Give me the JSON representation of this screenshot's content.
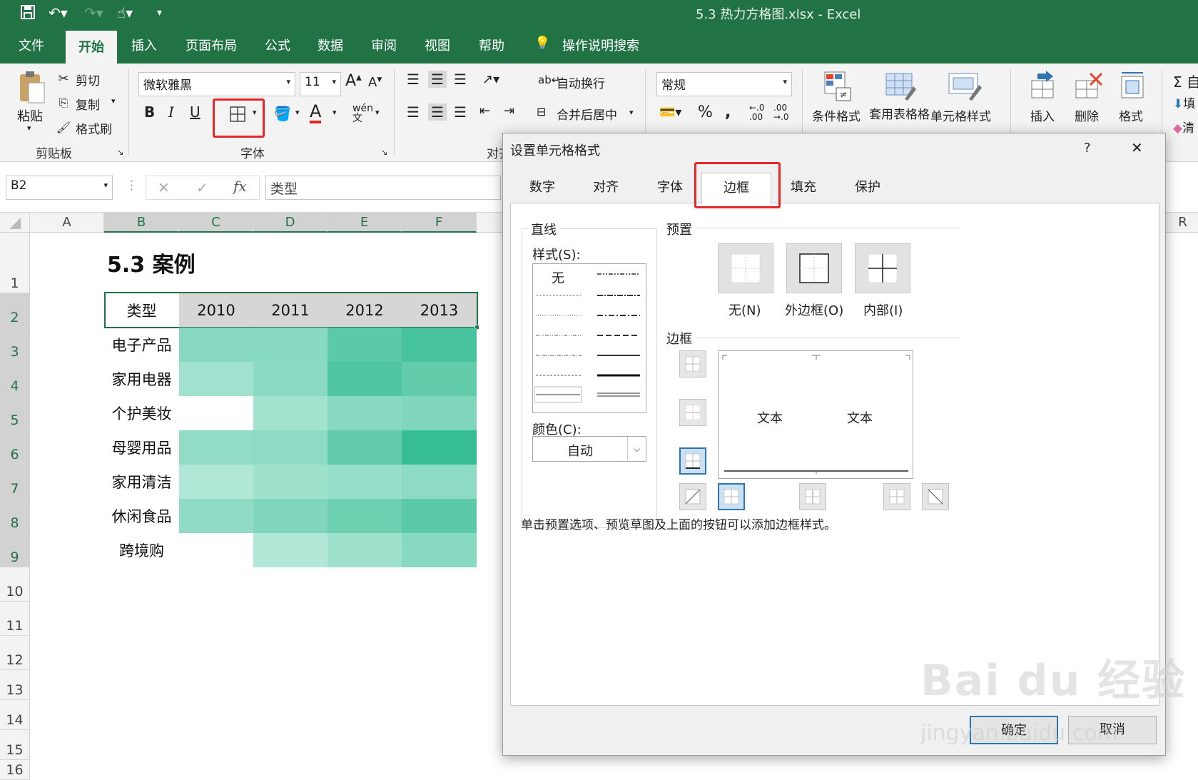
{
  "window": {
    "title": "5.3 热力方格图.xlsx  -  Excel"
  },
  "menu_tabs": [
    "文件",
    "开始",
    "插入",
    "页面布局",
    "公式",
    "数据",
    "审阅",
    "视图",
    "帮助"
  ],
  "tell_me": "操作说明搜索",
  "ribbon": {
    "clipboard": {
      "paste": "粘贴",
      "cut": "剪切",
      "copy": "复制",
      "format_painter": "格式刷",
      "label": "剪贴板"
    },
    "font": {
      "name": "微软雅黑",
      "size": "11",
      "bold": "B",
      "italic": "I",
      "underline": "U",
      "label": "字体"
    },
    "alignment": {
      "wrap": "自动换行",
      "merge": "合并后居中",
      "label": "对齐"
    },
    "number": {
      "format": "常规"
    },
    "styles": {
      "conditional": "条件格式",
      "table_format": "套用表格格式",
      "cell_styles": "单元格样式"
    },
    "cells": {
      "insert": "插入",
      "delete": "删除",
      "format": "格式"
    },
    "editing": {
      "autosum": "Σ 自",
      "fill": "填",
      "clear": "清"
    }
  },
  "formula_bar": {
    "name_box": "B2",
    "fx": "fx",
    "content": "类型"
  },
  "columns": [
    "A",
    "B",
    "C",
    "D",
    "E",
    "F"
  ],
  "col_r": "R",
  "rows": [
    "1",
    "2",
    "3",
    "4",
    "5",
    "6",
    "7",
    "8",
    "9",
    "10",
    "11",
    "12",
    "13",
    "14",
    "15",
    "16"
  ],
  "sheet": {
    "title": "5.3 案例",
    "header": [
      "类型",
      "2010",
      "2011",
      "2012",
      "2013"
    ],
    "categories": [
      "电子产品",
      "家用电器",
      "个护美妆",
      "母婴用品",
      "家用清洁",
      "休闲食品",
      "跨境购"
    ],
    "heat": [
      [
        "#86d8c0",
        "#88d9c2",
        "#5ccaa8",
        "#47c39f"
      ],
      [
        "#a0e2cf",
        "#8bdac4",
        "#4fc5a2",
        "#62ccab"
      ],
      [
        "#ffffff",
        "#a2e3d0",
        "#88d9c2",
        "#80d6bd"
      ],
      [
        "#92dcc7",
        "#8ddbc5",
        "#64ccac",
        "#36bd96"
      ],
      [
        "#b0e7d7",
        "#9ee1cd",
        "#98dfcb",
        "#8ddbc5"
      ],
      [
        "#8fdbc5",
        "#80d6bd",
        "#6bcfb0",
        "#5ccaa8"
      ],
      [
        "#ffffff",
        "#b3e8d9",
        "#9ee1cd",
        "#88d9c2"
      ]
    ]
  },
  "dialog": {
    "title": "设置单元格格式",
    "help": "?",
    "close": "✕",
    "tabs": [
      "数字",
      "对齐",
      "字体",
      "边框",
      "填充",
      "保护"
    ],
    "line_group": "直线",
    "style_label": "样式(S):",
    "style_none": "无",
    "color_label": "颜色(C):",
    "color_value": "自动",
    "presets_label": "预置",
    "preset_none": "无(N)",
    "preset_outline": "外边框(O)",
    "preset_inside": "内部(I)",
    "border_label": "边框",
    "preview_text1": "文本",
    "preview_text2": "文本",
    "hint": "单击预置选项、预览草图及上面的按钮可以添加边框样式。",
    "ok": "确定",
    "cancel": "取消"
  },
  "watermark": {
    "brand": "Bai du 经验",
    "url": "jingyan.baidu.com"
  }
}
